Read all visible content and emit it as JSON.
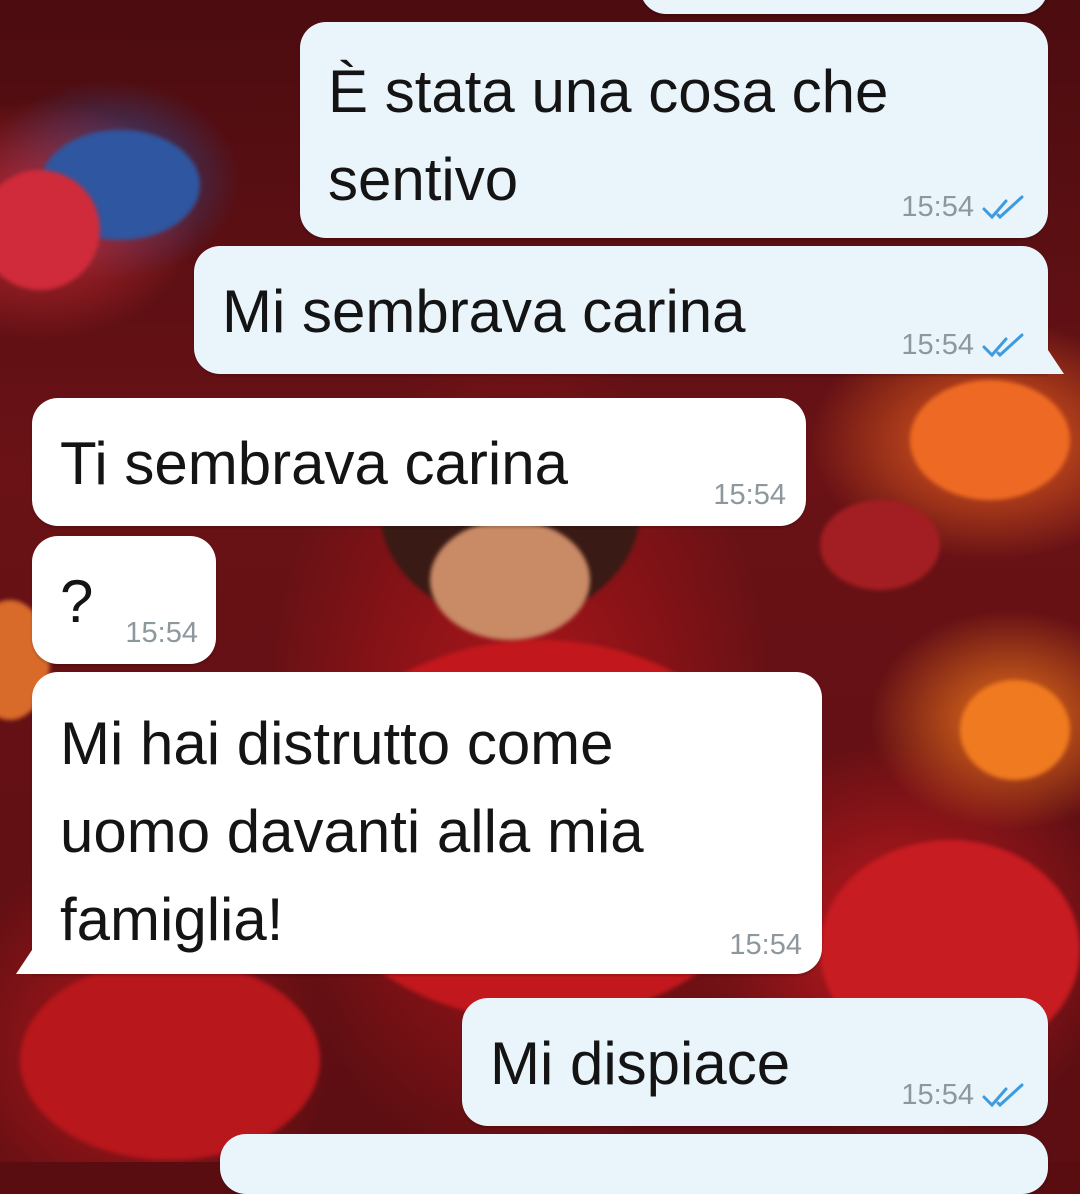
{
  "messages": [
    {
      "direction": "outgoing",
      "text": "È stata una cosa che\nsentivo",
      "time": "15:54",
      "status": "read-icon"
    },
    {
      "direction": "outgoing",
      "text": "Mi sembrava carina",
      "time": "15:54",
      "status": "read-icon"
    },
    {
      "direction": "incoming",
      "text": "Ti sembrava carina",
      "time": "15:54"
    },
    {
      "direction": "incoming",
      "text": "?",
      "time": "15:54"
    },
    {
      "direction": "incoming",
      "text": "Mi hai distrutto come\nuomo davanti alla mia\nfamiglia!",
      "time": "15:54"
    },
    {
      "direction": "outgoing",
      "text": "Mi dispiace",
      "time": "15:54",
      "status": "read-icon"
    }
  ],
  "colors": {
    "outgoing_bubble": "#e9f4fb",
    "incoming_bubble": "#ffffff",
    "read_ticks": "#3d9be0",
    "time_text": "#8c979e"
  }
}
